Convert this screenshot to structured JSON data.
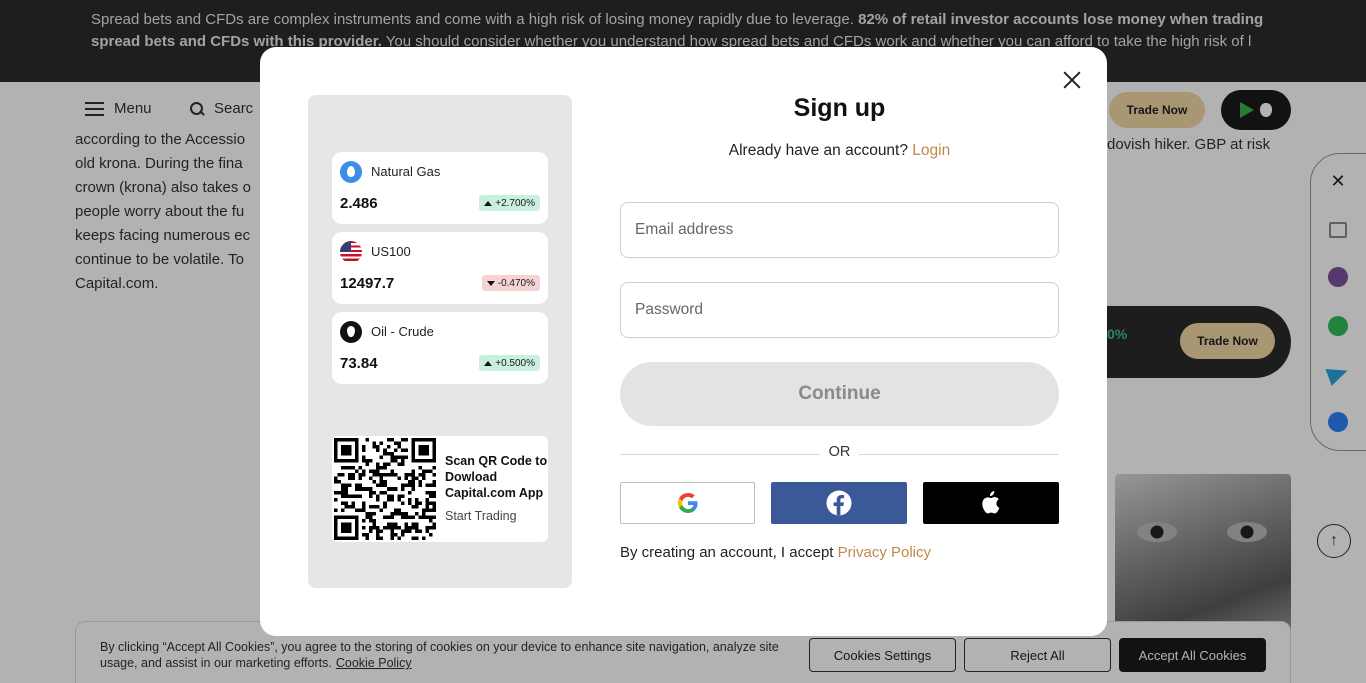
{
  "background": {
    "risk_banner": {
      "text_normal": "Spread bets and CFDs are complex instruments and come with a high risk of losing money rapidly due to leverage. ",
      "text_bold": "82% of retail investor accounts lose money when trading spread bets and CFDs with this provider.",
      "text_tail": " You should consider whether you understand how spread bets and CFDs work and whether you can afford to take the high risk of l"
    },
    "nav": {
      "menu_label": "Menu",
      "search_label": "Searc",
      "trade_now_label": "Trade Now"
    },
    "article_lines": [
      "according to the Accessio",
      "old krona. During the fina",
      "crown (krona) also takes o",
      "people worry about the fu",
      "keeps facing numerous ec",
      "continue to be volatile. To",
      "Capital.com."
    ],
    "article_right_line": "dovish hiker. GBP at risk",
    "card": {
      "pct": "0%",
      "trade_now_label": "Trade Now"
    },
    "cookie": {
      "text": "By clicking “Accept All Cookies”, you agree to the storing of cookies on your device to enhance site navigation, analyze site usage, and assist in our marketing efforts.",
      "policy_link": "Cookie Policy",
      "settings_label": "Cookies Settings",
      "reject_label": "Reject All",
      "accept_label": "Accept All Cookies"
    }
  },
  "modal": {
    "title": "Sign up",
    "have_account_text": "Already have an account?",
    "login_link": "Login",
    "email_placeholder": "Email address",
    "email_value": "",
    "password_placeholder": "Password",
    "password_value": "",
    "continue_label": "Continue",
    "or_label": "OR",
    "social": [
      "google-icon",
      "facebook-icon",
      "apple-icon"
    ],
    "legal_text": "By creating an account, I accept",
    "privacy_link": "Privacy Policy",
    "promo": {
      "assets": [
        {
          "name": "Natural Gas",
          "price": "2.486",
          "change": "+2.700%",
          "direction": "up",
          "icon": "flame-icon"
        },
        {
          "name": "US100",
          "price": "12497.7",
          "change": "-0.470%",
          "direction": "down",
          "icon": "us-flag-icon"
        },
        {
          "name": "Oil - Crude",
          "price": "73.84",
          "change": "+0.500%",
          "direction": "up",
          "icon": "oil-drop-icon"
        }
      ],
      "qr_title": "Scan QR Code to Dowload Capital.com App",
      "qr_subtitle": "Start Trading"
    }
  },
  "colors": {
    "accent_link": "#c0894a",
    "facebook": "#3b5998",
    "up_badge": "#c9efdf",
    "down_badge": "#f5d3d3",
    "trade_now_btn": "#f3d9a7"
  }
}
